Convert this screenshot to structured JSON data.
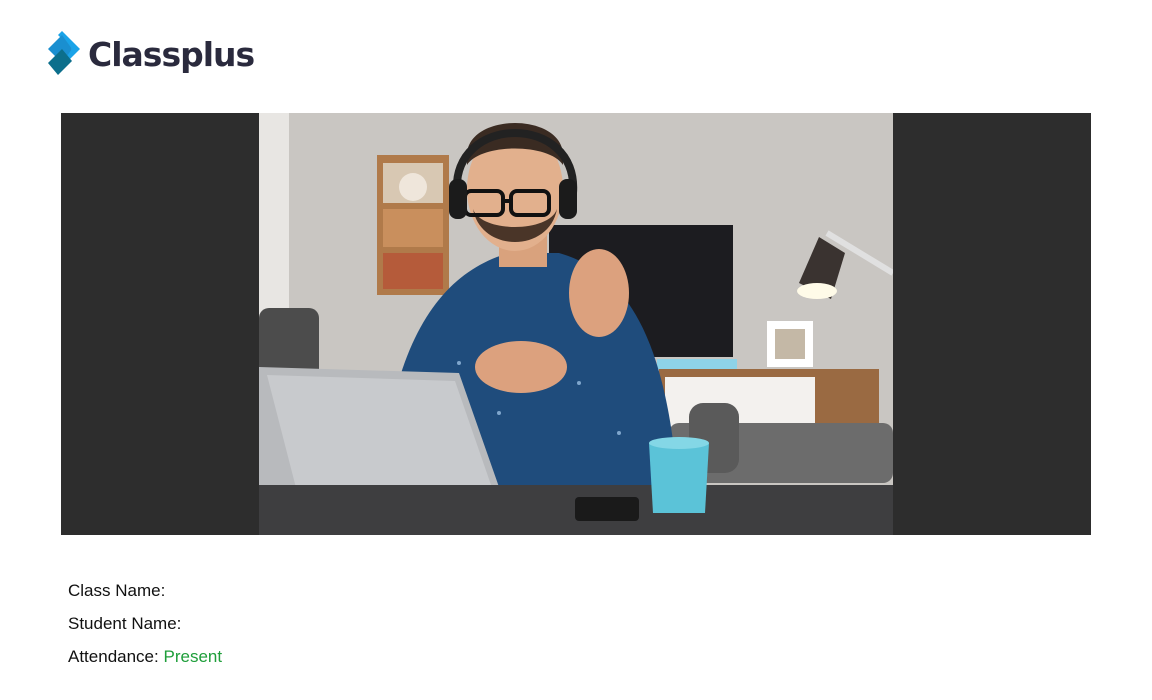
{
  "brand": {
    "name": "Classplus",
    "logo_colors": {
      "primary": "#1aa3e8",
      "secondary": "#0c6f8c",
      "text": "#2a2a3d"
    }
  },
  "media": {
    "frame_background": "#2d2d2d",
    "photo_subject": "man-with-headphones-on-video-call-icon"
  },
  "details": {
    "class_name_label": "Class Name:",
    "class_name_value": "",
    "student_name_label": "Student Name:",
    "student_name_value": "",
    "attendance_label": "Attendance:",
    "attendance_value": "Present",
    "attendance_color": "#1e9e3a"
  }
}
